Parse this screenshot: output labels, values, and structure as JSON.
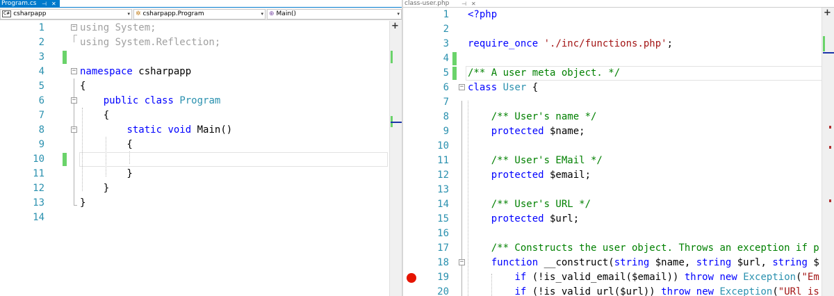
{
  "left": {
    "tab": {
      "title": "Program.cs",
      "pin_glyph": "⊣",
      "close_glyph": "✕"
    },
    "navbar": {
      "project": "csharpapp",
      "project_badge": "C#",
      "class": "csharpapp.Program",
      "class_glyph": "✲",
      "member": "Main()",
      "member_glyph": "⊕",
      "dropdown_arrow": "▾"
    },
    "split_button": "+",
    "lines": [
      {
        "n": "1",
        "segs": [
          {
            "c": "grey",
            "t": "using System;"
          }
        ]
      },
      {
        "n": "2",
        "segs": [
          {
            "c": "grey",
            "t": "using System.Reflection;"
          }
        ]
      },
      {
        "n": "3",
        "segs": []
      },
      {
        "n": "4",
        "segs": [
          {
            "c": "kw",
            "t": "namespace"
          },
          {
            "c": "",
            "t": " csharpapp"
          }
        ]
      },
      {
        "n": "5",
        "segs": [
          {
            "c": "",
            "t": "{"
          }
        ]
      },
      {
        "n": "6",
        "segs": [
          {
            "c": "",
            "t": "    "
          },
          {
            "c": "kw",
            "t": "public"
          },
          {
            "c": "",
            "t": " "
          },
          {
            "c": "kw",
            "t": "class"
          },
          {
            "c": "",
            "t": " "
          },
          {
            "c": "ty",
            "t": "Program"
          }
        ]
      },
      {
        "n": "7",
        "segs": [
          {
            "c": "",
            "t": "    {"
          }
        ]
      },
      {
        "n": "8",
        "segs": [
          {
            "c": "",
            "t": "        "
          },
          {
            "c": "kw",
            "t": "static"
          },
          {
            "c": "",
            "t": " "
          },
          {
            "c": "kw",
            "t": "void"
          },
          {
            "c": "",
            "t": " Main()"
          }
        ]
      },
      {
        "n": "9",
        "segs": [
          {
            "c": "",
            "t": "        {"
          }
        ]
      },
      {
        "n": "10",
        "segs": []
      },
      {
        "n": "11",
        "segs": [
          {
            "c": "",
            "t": "        }"
          }
        ]
      },
      {
        "n": "12",
        "segs": [
          {
            "c": "",
            "t": "    }"
          }
        ]
      },
      {
        "n": "13",
        "segs": [
          {
            "c": "",
            "t": "}"
          }
        ]
      },
      {
        "n": "14",
        "segs": []
      }
    ]
  },
  "right": {
    "tab": {
      "title": "class-user.php",
      "pin_glyph": "⊣",
      "close_glyph": "✕"
    },
    "split_button": "+",
    "lines": [
      {
        "n": "1",
        "segs": [
          {
            "c": "kw",
            "t": "<?php"
          }
        ]
      },
      {
        "n": "2",
        "segs": []
      },
      {
        "n": "3",
        "segs": [
          {
            "c": "kw",
            "t": "require_once"
          },
          {
            "c": "",
            "t": " "
          },
          {
            "c": "str",
            "t": "'./inc/functions.php'"
          },
          {
            "c": "",
            "t": ";"
          }
        ]
      },
      {
        "n": "4",
        "segs": []
      },
      {
        "n": "5",
        "segs": [
          {
            "c": "cm",
            "t": "/** A user meta object. */"
          }
        ]
      },
      {
        "n": "6",
        "segs": [
          {
            "c": "kw",
            "t": "class"
          },
          {
            "c": "",
            "t": " "
          },
          {
            "c": "ty",
            "t": "User"
          },
          {
            "c": "",
            "t": " {"
          }
        ]
      },
      {
        "n": "7",
        "segs": []
      },
      {
        "n": "8",
        "segs": [
          {
            "c": "",
            "t": "    "
          },
          {
            "c": "cm",
            "t": "/** User's name */"
          }
        ]
      },
      {
        "n": "9",
        "segs": [
          {
            "c": "",
            "t": "    "
          },
          {
            "c": "kw",
            "t": "protected"
          },
          {
            "c": "",
            "t": " $name;"
          }
        ]
      },
      {
        "n": "10",
        "segs": []
      },
      {
        "n": "11",
        "segs": [
          {
            "c": "",
            "t": "    "
          },
          {
            "c": "cm",
            "t": "/** User's EMail */"
          }
        ]
      },
      {
        "n": "12",
        "segs": [
          {
            "c": "",
            "t": "    "
          },
          {
            "c": "kw",
            "t": "protected"
          },
          {
            "c": "",
            "t": " $email;"
          }
        ]
      },
      {
        "n": "13",
        "segs": []
      },
      {
        "n": "14",
        "segs": [
          {
            "c": "",
            "t": "    "
          },
          {
            "c": "cm",
            "t": "/** User's URL */"
          }
        ]
      },
      {
        "n": "15",
        "segs": [
          {
            "c": "",
            "t": "    "
          },
          {
            "c": "kw",
            "t": "protected"
          },
          {
            "c": "",
            "t": " $url;"
          }
        ]
      },
      {
        "n": "16",
        "segs": []
      },
      {
        "n": "17",
        "segs": [
          {
            "c": "",
            "t": "    "
          },
          {
            "c": "cm",
            "t": "/** Constructs the user object. Throws an exception if p"
          }
        ]
      },
      {
        "n": "18",
        "segs": [
          {
            "c": "",
            "t": "    "
          },
          {
            "c": "kw",
            "t": "function"
          },
          {
            "c": "",
            "t": " __construct("
          },
          {
            "c": "kw",
            "t": "string"
          },
          {
            "c": "",
            "t": " $name, "
          },
          {
            "c": "kw",
            "t": "string"
          },
          {
            "c": "",
            "t": " $url, "
          },
          {
            "c": "kw",
            "t": "string"
          },
          {
            "c": "",
            "t": " $"
          }
        ]
      },
      {
        "n": "19",
        "segs": [
          {
            "c": "",
            "t": "        "
          },
          {
            "c": "kw",
            "t": "if"
          },
          {
            "c": "",
            "t": " (!is_valid_email($email)) "
          },
          {
            "c": "kw",
            "t": "throw"
          },
          {
            "c": "",
            "t": " "
          },
          {
            "c": "kw",
            "t": "new"
          },
          {
            "c": "",
            "t": " "
          },
          {
            "c": "ty",
            "t": "Exception"
          },
          {
            "c": "",
            "t": "("
          },
          {
            "c": "str",
            "t": "\"Em"
          }
        ]
      },
      {
        "n": "20",
        "segs": [
          {
            "c": "",
            "t": "        "
          },
          {
            "c": "kw",
            "t": "if"
          },
          {
            "c": "",
            "t": " (!is_valid_url($url)) "
          },
          {
            "c": "kw",
            "t": "throw"
          },
          {
            "c": "",
            "t": " "
          },
          {
            "c": "kw",
            "t": "new"
          },
          {
            "c": "",
            "t": " "
          },
          {
            "c": "ty",
            "t": "Exception"
          },
          {
            "c": "",
            "t": "("
          },
          {
            "c": "str",
            "t": "\"URl is"
          }
        ]
      }
    ]
  },
  "colors": {
    "accent": "#007acc",
    "keyword": "#0000ff",
    "type": "#2b91af",
    "comment": "#008000",
    "string": "#a31515",
    "line_number": "#2b91af",
    "change_marker": "#6ad36a",
    "breakpoint": "#e51400"
  }
}
